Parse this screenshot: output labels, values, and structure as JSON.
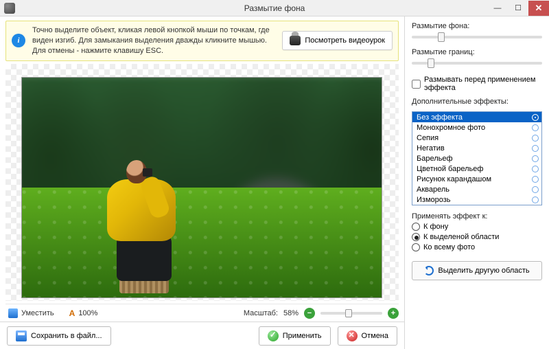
{
  "window": {
    "title": "Размытие фона"
  },
  "tip": {
    "text": "Точно выделите объект, кликая левой кнопкой мыши по точкам, где виден изгиб. Для замыкания выделения дважды кликните мышью. Для отмены - нажмите клавишу ESC.",
    "video_button": "Посмотреть видеоурок"
  },
  "status": {
    "fit_label": "Уместить",
    "actual_label": "100%",
    "zoom_label": "Масштаб:",
    "zoom_value": "58%"
  },
  "buttons": {
    "save": "Сохранить в файл...",
    "apply": "Применить",
    "cancel": "Отмена"
  },
  "panel": {
    "blur_bg_label": "Размытие фона:",
    "blur_edge_label": "Размытие границ:",
    "pre_blur_checkbox": "Размывать перед применением эффекта",
    "effects_label": "Дополнительные эффекты:",
    "effects": [
      "Без эффекта",
      "Монохромное фото",
      "Сепия",
      "Негатив",
      "Барельеф",
      "Цветной барельеф",
      "Рисунок карандашом",
      "Акварель",
      "Изморозь"
    ],
    "effects_selected_index": 0,
    "apply_to_label": "Применять эффект к:",
    "apply_to_options": [
      "К фону",
      "К выделеной области",
      "Ко всему фото"
    ],
    "apply_to_selected_index": 1,
    "select_other_button": "Выделить другую область"
  },
  "sliders": {
    "blur_bg_pct": 20,
    "blur_edge_pct": 12,
    "zoom_pct": 40
  }
}
